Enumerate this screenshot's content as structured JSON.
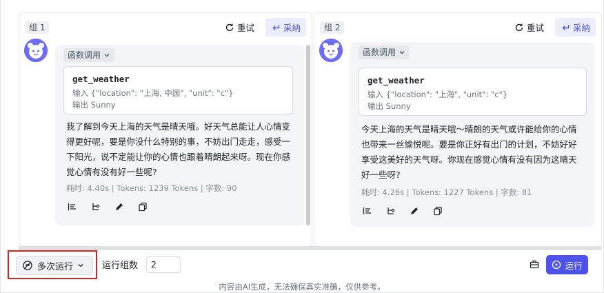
{
  "panels": [
    {
      "group_label": "组 1",
      "retry_label": "重试",
      "adopt_label": "采纳",
      "func_chip_label": "函数调用",
      "call": {
        "name": "get_weather",
        "input": "输入 {\"location\": \"上海, 中国\", \"unit\": \"c\"}",
        "output": "输出 Sunny"
      },
      "reply": "我了解到今天上海的天气是晴天哦。好天气总能让人心情变得更好呢，要是你没什么特别的事，不妨出门走走，感受一下阳光，说不定能让你的心情也跟着晴朗起来呀。现在你感觉心情有没有好一些呢?",
      "meta": "耗时: 4.40s | Tokens: 1239 Tokens | 字数: 90"
    },
    {
      "group_label": "组 2",
      "retry_label": "重试",
      "adopt_label": "采纳",
      "func_chip_label": "函数调用",
      "call": {
        "name": "get_weather",
        "input": "输入 {\"location\": \"上海\", \"unit\": \"c\"}",
        "output": "输出 Sunny"
      },
      "reply": "今天上海的天气是晴天哦～晴朗的天气或许能给你的心情也带来一丝愉悦呢。要是你正好有出门的计划，不妨好好享受这美好的天气呀。你现在感觉心情有没有因为这晴天好一些呀?",
      "meta": "耗时: 4.26s | Tokens: 1227 Tokens | 字数: 81"
    }
  ],
  "footer": {
    "multi_run_label": "多次运行",
    "group_count_label": "运行组数",
    "group_count_value": "2",
    "run_label": "运行",
    "disclaimer": "内容由AI生成，无法确保真实准确，仅供参考。"
  },
  "colors": {
    "accent": "#4d53e8",
    "accent_soft": "#eceefd",
    "avatar": "#6e6cf2",
    "highlight_border": "#e0201c"
  },
  "icons": {
    "retry": "refresh-icon",
    "adopt": "adopt-arrow-icon",
    "tools": [
      "align-icon",
      "branch-icon",
      "edit-icon",
      "copy-icon"
    ],
    "run": "play-circle-icon"
  }
}
